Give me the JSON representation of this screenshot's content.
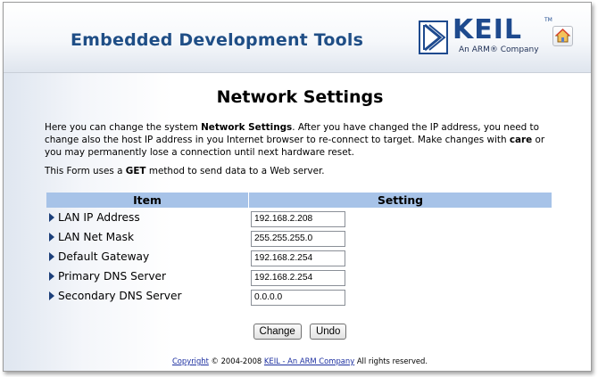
{
  "header": {
    "title": "Embedded Development Tools",
    "logo_word": "KEIL",
    "logo_tm": "TM",
    "logo_tagline": "An ARM® Company",
    "home_icon": "home-icon"
  },
  "page": {
    "title": "Network Settings",
    "intro_part1": "Here you can change the system ",
    "intro_bold1": "Network Settings",
    "intro_part2": ". After you have changed the IP address, you need to change also the host IP address in you Internet browser to re-connect to target. Make changes with ",
    "intro_bold2": "care",
    "intro_part3": " or you may permanently lose a connection until next hardware reset.",
    "form_note_part1": "This Form uses a ",
    "form_note_bold": "GET",
    "form_note_part2": " method to send data to a Web server."
  },
  "table": {
    "headers": [
      "Item",
      "Setting"
    ],
    "rows": [
      {
        "label": "LAN IP Address",
        "value": "192.168.2.208"
      },
      {
        "label": "LAN Net Mask",
        "value": "255.255.255.0"
      },
      {
        "label": "Default Gateway",
        "value": "192.168.2.254"
      },
      {
        "label": "Primary DNS Server",
        "value": "192.168.2.254"
      },
      {
        "label": "Secondary DNS Server",
        "value": "0.0.0.0"
      }
    ]
  },
  "buttons": {
    "change": "Change",
    "undo": "Undo"
  },
  "footer": {
    "copyright_link": "Copyright",
    "text1": " © 2004-2008 ",
    "company_link": "KEIL - An ARM Company",
    "text2": " All rights reserved."
  },
  "colors": {
    "title_blue": "#1f4e86",
    "logo_blue": "#1e4a8e",
    "table_header": "#a7c3e8",
    "link": "#1c2fa0"
  }
}
